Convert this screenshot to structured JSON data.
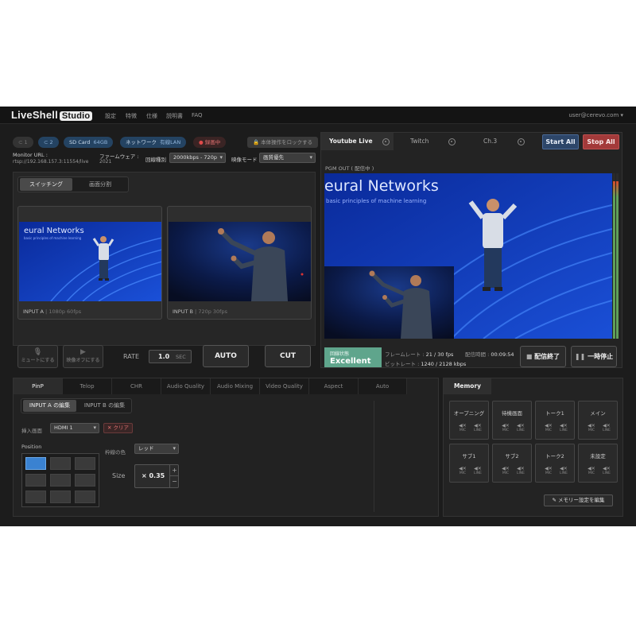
{
  "app": {
    "logo": "LiveShell",
    "logo_badge": "Studio",
    "nav": [
      "設定",
      "特徴",
      "仕様",
      "説明書",
      "FAQ"
    ],
    "user": "user@cerevo.com ▾"
  },
  "status": {
    "input1": "1",
    "input2": "2",
    "sd_label": "SD Card",
    "sd_size": "64GB",
    "net_label": "ネットワーク",
    "net_value": "有線LAN",
    "recording": "録画中",
    "lock_button": "本体操作をロックする"
  },
  "info": {
    "monitor_label": "Monitor URL :",
    "monitor_url": "rtsp://192.168.157.3:11554/live",
    "firmware_label": "ファームウェア :",
    "firmware_value": "2021",
    "line_label": "回線種別",
    "line_value": "2000kbps - 720p",
    "video_mode_label": "映像モード",
    "video_mode_value": "画質優先"
  },
  "switcher": {
    "tabs": [
      "スイッチング",
      "画面分割"
    ],
    "input_a_label": "INPUT A",
    "input_a_format": "1080p 60fps",
    "input_b_label": "INPUT B",
    "input_b_format": "720p 30fps",
    "mute_label": "ミュートにする",
    "video_off_label": "映像オフにする",
    "rate_label": "RATE",
    "rate_value": "1.0",
    "rate_unit": "SEC",
    "auto_label": "AUTO",
    "cut_label": "CUT"
  },
  "slide": {
    "line1": "eural Networks",
    "line2": "basic principles of machine learning"
  },
  "channels": {
    "tabs": [
      "Youtube Live",
      "Twitch",
      "Ch.3"
    ],
    "start_all": "Start All",
    "stop_all": "Stop All",
    "pgm_label": "PGM OUT ( 配信中 )",
    "line_state_label": "回線状態",
    "line_state_value": "Excellent",
    "framerate_label": "フレームレート :",
    "framerate_value": "21 / 30 fps",
    "bitrate_label": "ビットレート :",
    "bitrate_value": "1240 / 2128 kbps",
    "time_label": "配信時間 :",
    "time_value": "00:09:54",
    "end_button": "配信終了",
    "pause_button": "一時停止"
  },
  "bottom": {
    "tabs": [
      "PinP",
      "Telop",
      "CHR",
      "Audio Quality",
      "Audio Mixing",
      "Video Quality",
      "Aspect",
      "Auto"
    ],
    "edit_tabs": [
      "INPUT A の編集",
      "INPUT B の編集"
    ],
    "insert_label": "挿入画面",
    "insert_value": "HDMI 1",
    "clear_label": "クリア",
    "position_label": "Position",
    "frame_color_label": "枠線の色",
    "frame_color_value": "レッド",
    "size_label": "Size",
    "size_value": "× 0.35",
    "plus": "+",
    "minus": "−"
  },
  "memory": {
    "title": "Memory",
    "slots": [
      "オープニング",
      "待機画面",
      "トーク1",
      "メイン",
      "サブ1",
      "サブ2",
      "トーク2",
      "未設定"
    ],
    "mic": "MIC",
    "line": "LINE",
    "edit_button": "メモリー設定を編集"
  },
  "colors": {
    "accent": "#3a82d1",
    "good": "#5fa58c",
    "stop": "#a33a3a",
    "start": "#2d4669"
  }
}
